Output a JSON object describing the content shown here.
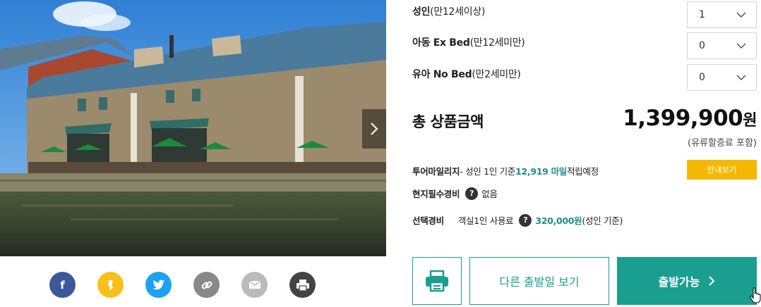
{
  "passengers": [
    {
      "type_bold": "성인",
      "type_note": "(만12세이상)",
      "value": "1"
    },
    {
      "type_bold": "아동 Ex Bed",
      "type_note": "(만12세미만)",
      "value": "0"
    },
    {
      "type_bold": "유아 No Bed",
      "type_note": "(만2세미만)",
      "value": "0"
    }
  ],
  "total": {
    "label": "총 상품금액",
    "amount": "1,399,900",
    "currency": "원",
    "note": "(유류할증료 포함)"
  },
  "mileage": {
    "label": "투어마일리지",
    "text_before": " - 성인 1인 기준 ",
    "amount": "12,919 마일",
    "text_after": " 적립예정",
    "guide_button": "안내보기"
  },
  "local_fee": {
    "label": "현지필수경비",
    "value": "없음"
  },
  "optional_fee": {
    "label": "선택경비",
    "item": "객실1인 사용료",
    "amount": "320,000원",
    "suffix": "(성인 기준)"
  },
  "buttons": {
    "other_dates": "다른 출발일 보기",
    "depart": "출발가능"
  },
  "share_icons": [
    "facebook-icon",
    "kakaostory-icon",
    "twitter-icon",
    "link-icon",
    "email-icon",
    "print-icon"
  ],
  "colors": {
    "accent": "#1a9e8f",
    "guide": "#f5b800",
    "facebook": "#3b5998",
    "kakaostory": "#f9c01a",
    "twitter": "#1da1f2",
    "link": "#888888",
    "email": "#bbbbbb",
    "print": "#444444"
  }
}
